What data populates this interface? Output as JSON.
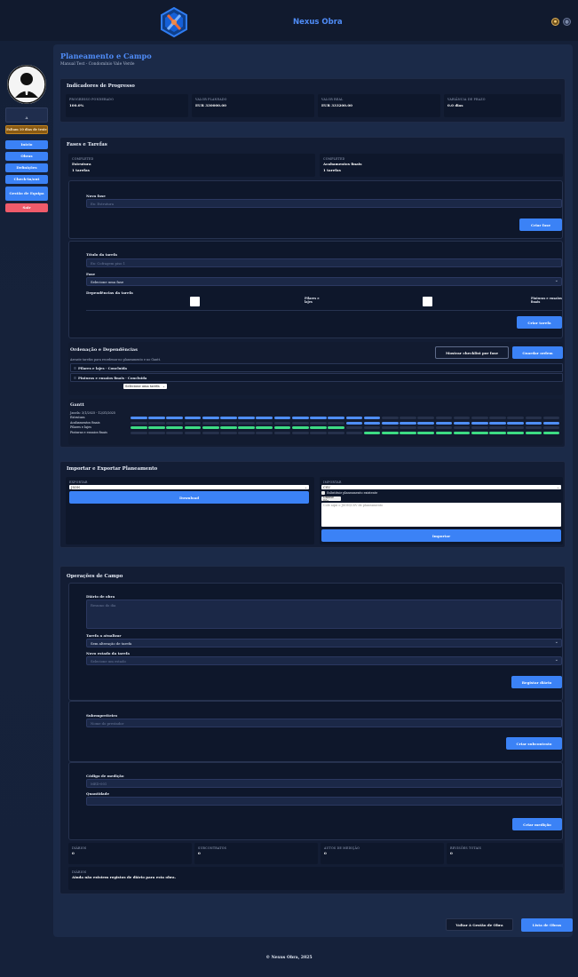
{
  "header": {
    "brand": "Nexus Obra",
    "icons": [
      "settings-icon",
      "globe-icon"
    ]
  },
  "sidebar": {
    "box_text": "A",
    "trial_badge": "Faltam 10 dias de teste",
    "items": [
      {
        "label": "Início"
      },
      {
        "label": "Obras"
      },
      {
        "label": "Definições"
      },
      {
        "label": "Check-in/out"
      },
      {
        "label": "Gestão de Equipa"
      },
      {
        "label": "Sair"
      }
    ]
  },
  "page": {
    "title": "Planeamento e Campo",
    "subtitle": "Manual Test - Condomínio Vale Verde"
  },
  "progress": {
    "title": "Indicadores de Progresso",
    "stats": [
      {
        "label": "PROGRESSO PONDERADO",
        "value": "100.0%"
      },
      {
        "label": "VALOR PLANEADO",
        "value": "EUR 330000.00"
      },
      {
        "label": "VALOR REAL",
        "value": "EUR 333200.00"
      },
      {
        "label": "VARIÂNCIA DE PRAZO",
        "value": "0.0 dias"
      }
    ]
  },
  "phases": {
    "title": "Fases e Tarefas",
    "cards": [
      {
        "status": "COMPLETED",
        "name": "Estrutura",
        "count": "1 tarefas"
      },
      {
        "status": "COMPLETED",
        "name": "Acabamentos finais",
        "count": "1 tarefas"
      }
    ],
    "new_phase": {
      "label": "Nova fase",
      "placeholder": "Ex: Estrutura",
      "button": "Criar fase"
    },
    "new_task": {
      "title_label": "Título da tarefa",
      "title_placeholder": "Ex: Cofragem piso 1",
      "phase_label": "Fase",
      "phase_value": "Selecione uma fase",
      "deps_label": "Dependências da tarefa",
      "deps": [
        "Pilares e lajes",
        "Pinturas e ensaios finais"
      ],
      "button": "Criar tarefa"
    },
    "ordering": {
      "title": "Ordenação e Dependências",
      "hint": "Arraste tarefas para reordenar no planeamento e no Gantt.",
      "btn_checklist": "Mostrar checklist por fase",
      "btn_save": "Guardar ordem",
      "tasks": [
        {
          "label": "Pilares e lajes · Concluída"
        },
        {
          "label": "Pinturas e ensaios finais · Concluída"
        }
      ],
      "select_value": "Selecione uma tarefa"
    },
    "gantt": {
      "title": "Gantt",
      "range": "Janela: 3/1/2025 - 12/31/2025",
      "rows": [
        {
          "label": "Estrutura",
          "start": 0,
          "end": 14,
          "color": "#4f8ef7"
        },
        {
          "label": "Acabamentos finais",
          "start": 12,
          "end": 24,
          "color": "#4f8ef7"
        },
        {
          "label": "Pilares e lajes",
          "start": 0,
          "end": 12,
          "color": "#3ddc84"
        },
        {
          "label": "Pinturas e ensaios finais",
          "start": 13,
          "end": 24,
          "color": "#3ddc84"
        }
      ],
      "total_cells": 24
    }
  },
  "import_export": {
    "title": "Importar e Exportar Planeamento",
    "export_label": "EXPORTAR",
    "export_format": "JSON",
    "download": "Download",
    "import_label": "IMPORTAR",
    "import_format": "CSV",
    "replace_label": "Substituir planeamento existente",
    "choose_file": "Choose File",
    "textarea_placeholder": "Cole aqui o JSON/CSV de planeamento",
    "import_button": "Importar"
  },
  "field_ops": {
    "title": "Operações de Campo",
    "diary": {
      "label": "Diário de obra",
      "placeholder": "Resumo do dia",
      "task_label": "Tarefa a atualizar",
      "task_value": "Sem alteração de tarefa",
      "state_label": "Novo estado da tarefa",
      "state_placeholder": "Selecione um estado",
      "button": "Registar diário"
    },
    "subcontract": {
      "label": "Subempreiteiro",
      "placeholder": "Nome do prestador",
      "button": "Criar subcontrato"
    },
    "measurement": {
      "code_label": "Código de medição",
      "code_placeholder": "MED-001",
      "qty_label": "Quantidade",
      "button": "Criar medição"
    },
    "stats": [
      {
        "label": "DIÁRIOS",
        "value": "0"
      },
      {
        "label": "SUBCONTRATOS",
        "value": "0"
      },
      {
        "label": "AUTOS DE MEDIÇÃO",
        "value": "0"
      },
      {
        "label": "REVISÕES TOTAIS",
        "value": "0"
      }
    ],
    "diaries_label": "DIÁRIOS",
    "diaries_empty": "Ainda não existem registos de diário para esta obra."
  },
  "actions": {
    "back": "Voltar à Gestão de Obra",
    "list": "Lista de Obras"
  },
  "footer": "© Nexus Obra, 2025",
  "colors": {
    "accent": "#3b82f6",
    "title_blue": "#4f8cf7",
    "danger": "#ef5b6a",
    "gantt_blue": "#4f8ef7",
    "gantt_green": "#3ddc84"
  }
}
